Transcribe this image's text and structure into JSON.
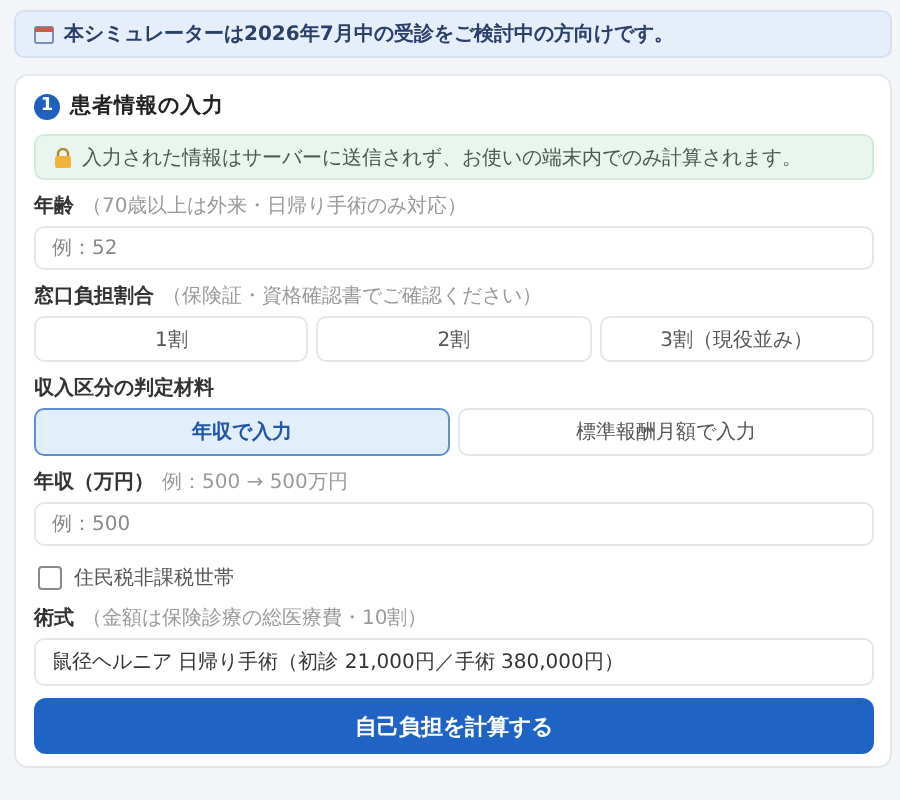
{
  "banner": {
    "text": "本シミュレーターは2026年7月中の受診をご検討中の方向けです。"
  },
  "section": {
    "number": "1",
    "title": "患者情報の入力"
  },
  "notice": {
    "text": "入力された情報はサーバーに送信されず、お使いの端末内でのみ計算されます。"
  },
  "age": {
    "label": "年齢",
    "hint": "（70歳以上は外来・日帰り手術のみ対応）",
    "placeholder": "例：52"
  },
  "ratio": {
    "label": "窓口負担割合",
    "hint": "（保険証・資格確認書でご確認ください）",
    "options": [
      {
        "label": "1割",
        "selected": false
      },
      {
        "label": "2割",
        "selected": false
      },
      {
        "label": "3割（現役並み）",
        "selected": false
      }
    ]
  },
  "income_basis": {
    "label": "収入区分の判定材料",
    "options": [
      {
        "label": "年収で入力",
        "selected": true
      },
      {
        "label": "標準報酬月額で入力",
        "selected": false
      }
    ]
  },
  "income": {
    "label": "年収（万円）",
    "hint": "例：500 → 500万円",
    "placeholder": "例：500"
  },
  "tax_exempt": {
    "label": "住民税非課税世帯",
    "checked": false
  },
  "procedure": {
    "label": "術式",
    "hint": "（金額は保険診療の総医療費・10割）",
    "value": "鼠径ヘルニア 日帰り手術（初診 21,000円／手術 380,000円）"
  },
  "submit": {
    "label": "自己負担を計算する"
  }
}
